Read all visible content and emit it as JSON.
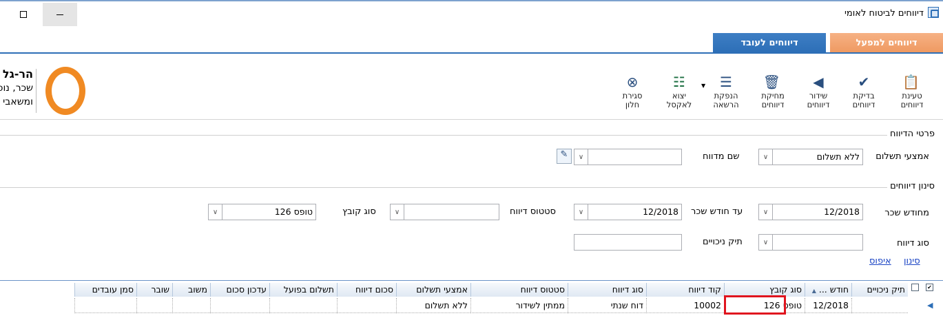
{
  "window": {
    "title": "דיווחים לביטוח לאומי",
    "icon": "app-icon",
    "buttons": [
      "maximize-icon",
      "minimize-icon"
    ]
  },
  "tabs": [
    {
      "label": "דיווחים למפעל",
      "active": true,
      "color": "#ef9a62"
    },
    {
      "label": "דיווחים לעובד",
      "active": false,
      "color": "#2d6fb7"
    }
  ],
  "ribbon": {
    "buttons": [
      {
        "label1": "טעינת",
        "label2": "דיווחים",
        "icon": "upload-clipboard-icon"
      },
      {
        "label1": "בדיקת",
        "label2": "דיווחים",
        "icon": "check-shield-icon"
      },
      {
        "label1": "שידור",
        "label2": "דיווחים",
        "icon": "send-arrow-icon"
      },
      {
        "label1": "מחיקת",
        "label2": "דיווחים",
        "icon": "trash-icon"
      },
      {
        "label1": "הנפקת",
        "label2": "הרשאה",
        "icon": "list-add-icon"
      },
      {
        "label1": "יצוא",
        "label2": "לאקסל",
        "icon": "excel-icon"
      },
      {
        "label1": "סגירת",
        "label2": "חלון",
        "icon": "close-circle-icon"
      }
    ],
    "logo": {
      "line1": "הר-גל",
      "line2": "שכר, נוכחות",
      "line3": "ומשאבי אנוש",
      "color": "#f08a23"
    }
  },
  "report_details": {
    "title": "פרטי הדיווח",
    "payment_method_label": "אמצעי תשלום",
    "payment_method_value": "ללא תשלום",
    "reporter_name_label": "שם מדווח",
    "reporter_name_value": ""
  },
  "filter": {
    "title": "סינון דיווחים",
    "from_month_label": "מחודש שכר",
    "from_month_value": "12/2018",
    "to_month_label": "עד חודש שכר",
    "to_month_value": "12/2018",
    "status_label": "סטטוס דיווח",
    "status_value": "",
    "file_type_label": "סוג קובץ",
    "file_type_value": "טופס 126",
    "report_type_label": "סוג דיווח",
    "report_type_value": "",
    "deductions_file_label": "תיק ניכויים",
    "deductions_file_value": "",
    "filter_link": "סינון",
    "reset_link": "איפוס"
  },
  "grid": {
    "columns": [
      "תיק ניכויים",
      "חודש ...",
      "סוג קובץ",
      "קוד דיווח",
      "סוג דיווח",
      "סטטוס דיווח",
      "אמצעי תשלום",
      "סכום דיווח",
      "תשלום בפועל",
      "עדכון סכום",
      "משוב",
      "שובר",
      "סמן עובדים"
    ],
    "rows": [
      {
        "deductions_file": "",
        "month": "12/2018",
        "file_type": "טופס 126",
        "report_code": "10002",
        "report_type": "דוח שנתי",
        "status": "ממתין לשידור",
        "payment_method": "ללא תשלום",
        "amount": "",
        "actual_payment": "",
        "update_amount": "",
        "feedback": "",
        "voucher": "",
        "mark_employees": ""
      }
    ]
  }
}
